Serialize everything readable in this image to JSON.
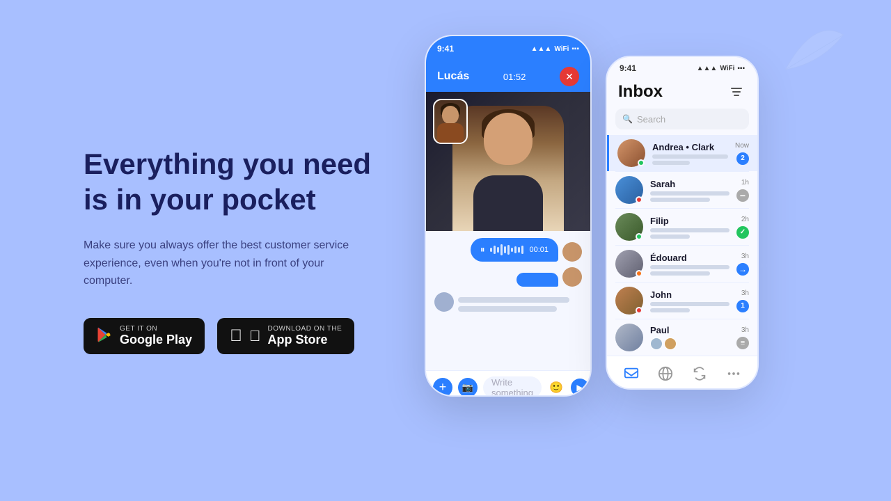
{
  "page": {
    "background_color": "#a8bfff",
    "headline": "Everything you need is in your pocket",
    "subtext": "Make sure you always offer the best customer service experience, even when you're not in front of your computer.",
    "google_play": {
      "label_small": "GET IT ON",
      "label_big": "Google Play"
    },
    "app_store": {
      "label_small": "Download on the",
      "label_big": "App Store"
    },
    "phone1": {
      "status_time": "9:41",
      "caller_name": "Lucás",
      "call_duration": "01:52",
      "input_placeholder": "Write something"
    },
    "phone2": {
      "status_time": "9:41",
      "inbox_title": "Inbox",
      "search_placeholder": "Search",
      "contacts": [
        {
          "name": "Andrea",
          "suffix": "Clark",
          "time": "Now",
          "badge": "2",
          "badge_type": "blue",
          "dot": "green",
          "active": true
        },
        {
          "name": "Sarah",
          "time": "1h",
          "badge": "—",
          "badge_type": "minus",
          "dot": "red",
          "active": false
        },
        {
          "name": "Filip",
          "time": "2h",
          "badge": "✓",
          "badge_type": "green-check",
          "dot": "green",
          "active": false
        },
        {
          "name": "Édouard",
          "time": "3h",
          "badge": "→",
          "badge_type": "blue-arrow",
          "dot": "orange",
          "active": false
        },
        {
          "name": "John",
          "time": "3h",
          "badge": "1",
          "badge_type": "blue",
          "dot": "red",
          "active": false
        },
        {
          "name": "Paul",
          "time": "3h",
          "badge": "≡",
          "badge_type": "grey-menu",
          "dot": "none",
          "active": false
        }
      ]
    }
  }
}
